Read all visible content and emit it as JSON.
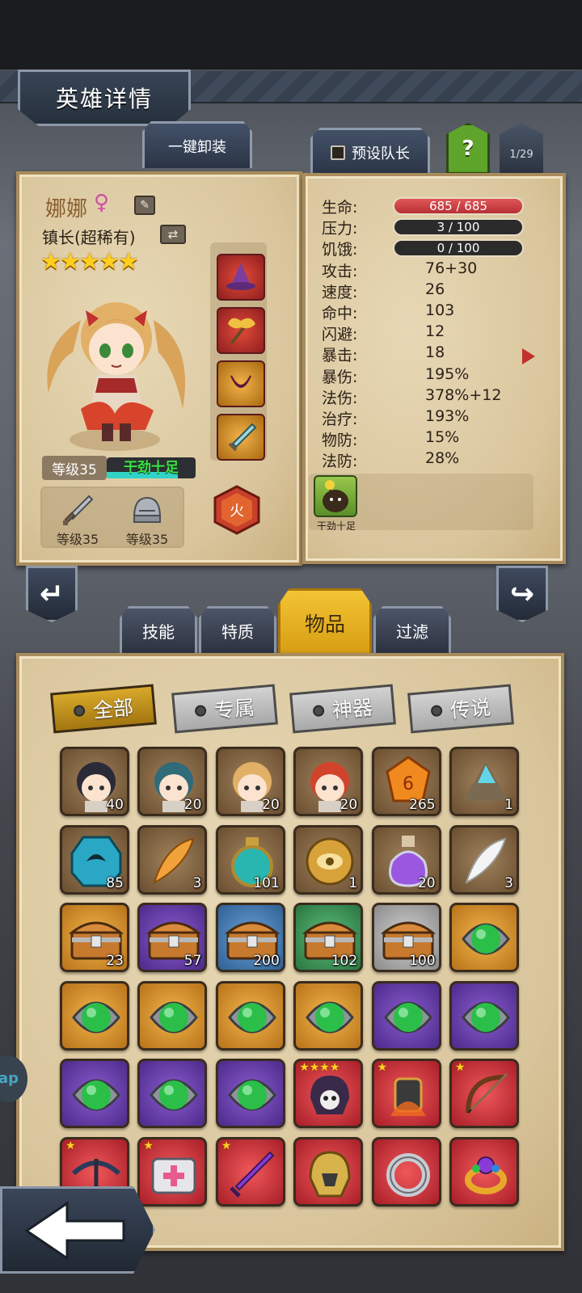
{
  "header": {
    "title": "英雄详情",
    "unequip_all": "一键卸装",
    "preset_leader": "预设队长",
    "help_label": "?",
    "page_counter": "1/29"
  },
  "hero": {
    "name": "娜娜",
    "gender_symbol": "♀",
    "title": "镇长(超稀有)",
    "stars": "★★★★★",
    "level_label": "等级35",
    "mood_label": "干劲十足",
    "mood_fill": 0.8,
    "weapon_level": "等级35",
    "armor_level": "等级35",
    "element": "火"
  },
  "stats": [
    {
      "label": "生命:",
      "value": "685 / 685",
      "bar": "red"
    },
    {
      "label": "压力:",
      "value": "3 / 100",
      "bar": "dark"
    },
    {
      "label": "饥饿:",
      "value": "0 / 100",
      "bar": "dark"
    },
    {
      "label": "攻击:",
      "value": "76+30"
    },
    {
      "label": "速度:",
      "value": "26"
    },
    {
      "label": "命中:",
      "value": "103"
    },
    {
      "label": "闪避:",
      "value": "12"
    },
    {
      "label": "暴击:",
      "value": "18"
    },
    {
      "label": "暴伤:",
      "value": "195%"
    },
    {
      "label": "法伤:",
      "value": "378%+12"
    },
    {
      "label": "治疗:",
      "value": "193%"
    },
    {
      "label": "物防:",
      "value": "15%"
    },
    {
      "label": "法防:",
      "value": "28%"
    }
  ],
  "trait": {
    "label": "干劲十足"
  },
  "tabs": [
    {
      "label": "技能",
      "active": false
    },
    {
      "label": "特质",
      "active": false
    },
    {
      "label": "物品",
      "active": true
    },
    {
      "label": "过滤",
      "active": false
    }
  ],
  "filters": [
    {
      "label": "全部",
      "active": true
    },
    {
      "label": "专属",
      "active": false
    },
    {
      "label": "神器",
      "active": false
    },
    {
      "label": "传说",
      "active": false
    }
  ],
  "inventory": [
    {
      "icon": "hero-portrait-black-hair-icon",
      "count": "40",
      "frame": "brown"
    },
    {
      "icon": "hero-portrait-teal-hair-icon",
      "count": "20",
      "frame": "brown"
    },
    {
      "icon": "hero-portrait-blonde-hair-icon",
      "count": "20",
      "frame": "brown"
    },
    {
      "icon": "hero-portrait-red-hair-icon",
      "count": "20",
      "frame": "brown"
    },
    {
      "icon": "amber-gem-icon",
      "count": "265",
      "frame": "brown"
    },
    {
      "icon": "crystal-ore-icon",
      "count": "1",
      "frame": "brown"
    },
    {
      "icon": "rune-stone-icon",
      "count": "85",
      "frame": "brown"
    },
    {
      "icon": "golden-feather-icon",
      "count": "3",
      "frame": "brown"
    },
    {
      "icon": "teal-potion-icon",
      "count": "101",
      "frame": "brown"
    },
    {
      "icon": "golden-eye-medal-icon",
      "count": "1",
      "frame": "brown"
    },
    {
      "icon": "purple-potion-icon",
      "count": "20",
      "frame": "brown"
    },
    {
      "icon": "white-feather-icon",
      "count": "3",
      "frame": "brown"
    },
    {
      "icon": "treasure-chest-icon",
      "count": "23",
      "frame": "orange"
    },
    {
      "icon": "treasure-chest-icon",
      "count": "57",
      "frame": "purple"
    },
    {
      "icon": "treasure-chest-icon",
      "count": "200",
      "frame": "blue"
    },
    {
      "icon": "treasure-chest-icon",
      "count": "102",
      "frame": "green"
    },
    {
      "icon": "treasure-chest-icon",
      "count": "100",
      "frame": "gray"
    },
    {
      "icon": "green-orb-icon",
      "count": "",
      "frame": "orange"
    },
    {
      "icon": "green-orb-icon",
      "count": "",
      "frame": "orange"
    },
    {
      "icon": "green-orb-icon",
      "count": "",
      "frame": "orange"
    },
    {
      "icon": "green-orb-icon",
      "count": "",
      "frame": "orange"
    },
    {
      "icon": "green-orb-icon",
      "count": "",
      "frame": "orange"
    },
    {
      "icon": "green-orb-icon",
      "count": "",
      "frame": "purple"
    },
    {
      "icon": "green-orb-icon",
      "count": "",
      "frame": "purple"
    },
    {
      "icon": "green-orb-icon",
      "count": "",
      "frame": "purple"
    },
    {
      "icon": "green-orb-icon",
      "count": "",
      "frame": "purple"
    },
    {
      "icon": "green-orb-icon",
      "count": "",
      "frame": "purple"
    },
    {
      "icon": "skull-helmet-icon",
      "count": "",
      "frame": "red",
      "stars": "★★★★"
    },
    {
      "icon": "fire-gauntlet-icon",
      "count": "",
      "frame": "red",
      "stars": "★"
    },
    {
      "icon": "bow-arrow-icon",
      "count": "",
      "frame": "red",
      "stars": "★"
    },
    {
      "icon": "crossbow-icon",
      "count": "",
      "frame": "red",
      "stars": "★"
    },
    {
      "icon": "medkit-icon",
      "count": "",
      "frame": "red",
      "stars": "★"
    },
    {
      "icon": "purple-dagger-icon",
      "count": "",
      "frame": "red",
      "stars": "★"
    },
    {
      "icon": "golden-helmet-icon",
      "count": "",
      "frame": "red"
    },
    {
      "icon": "silver-ring-icon",
      "count": "",
      "frame": "red"
    },
    {
      "icon": "jeweled-ring-icon",
      "count": "",
      "frame": "red"
    }
  ],
  "side_chip": "ap",
  "colors": {
    "accent_gold": "#f3c433",
    "parchment": "#e7d8b5",
    "hp_red": "#c9373d",
    "mood_green": "#3ee24a"
  }
}
